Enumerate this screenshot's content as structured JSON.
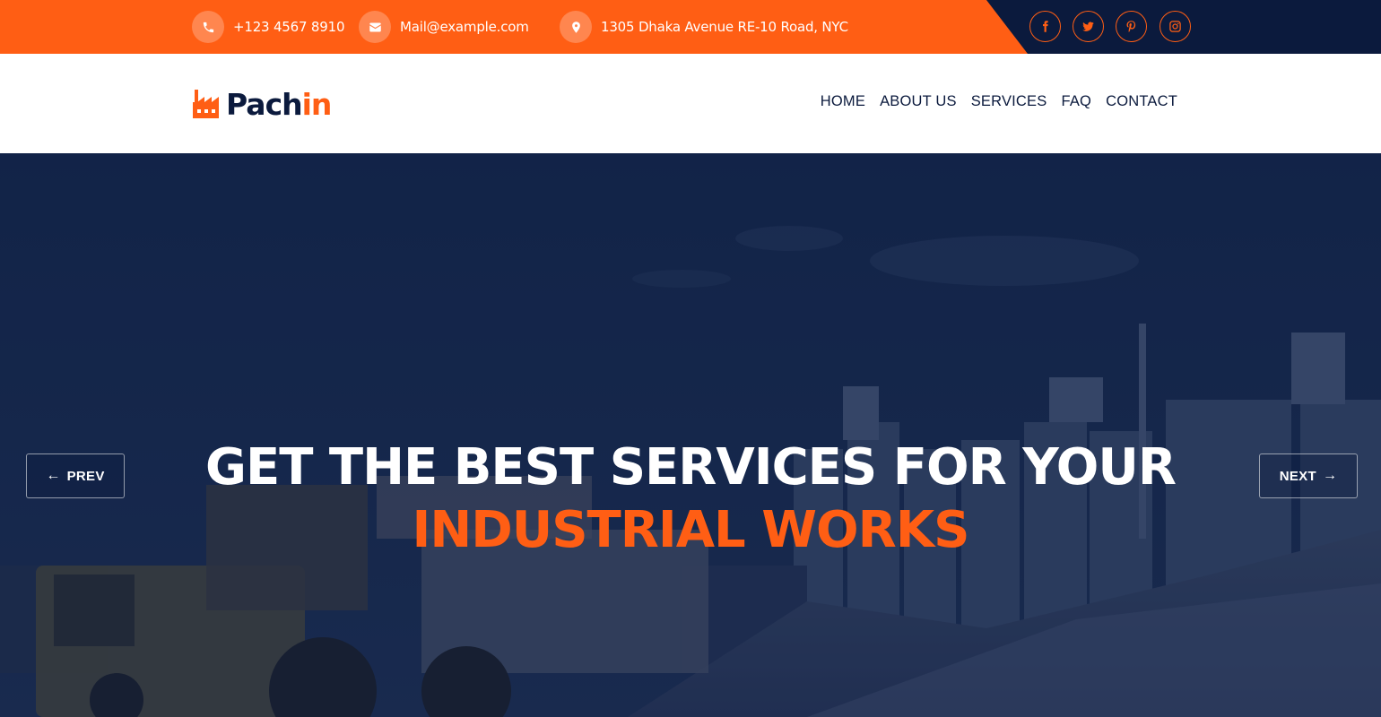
{
  "topbar": {
    "phone": "+123 4567 8910",
    "email": "Mail@example.com",
    "address": "1305 Dhaka Avenue RE-10 Road, NYC",
    "social": [
      "facebook-icon",
      "twitter-icon",
      "pinterest-icon",
      "instagram-icon"
    ]
  },
  "brand": {
    "name_main": "Pach",
    "name_accent": "in"
  },
  "nav": {
    "items": [
      "HOME",
      "ABOUT US",
      "SERVICES",
      "FAQ",
      "CONTACT"
    ]
  },
  "hero": {
    "title_line1": "GET THE BEST SERVICES FOR YOUR",
    "title_line2": "INDUSTRIAL WORKS",
    "prev_label": "PREV",
    "next_label": "NEXT"
  },
  "colors": {
    "accent": "#ff5e14",
    "navy": "#0b1a3d",
    "white": "#ffffff"
  }
}
